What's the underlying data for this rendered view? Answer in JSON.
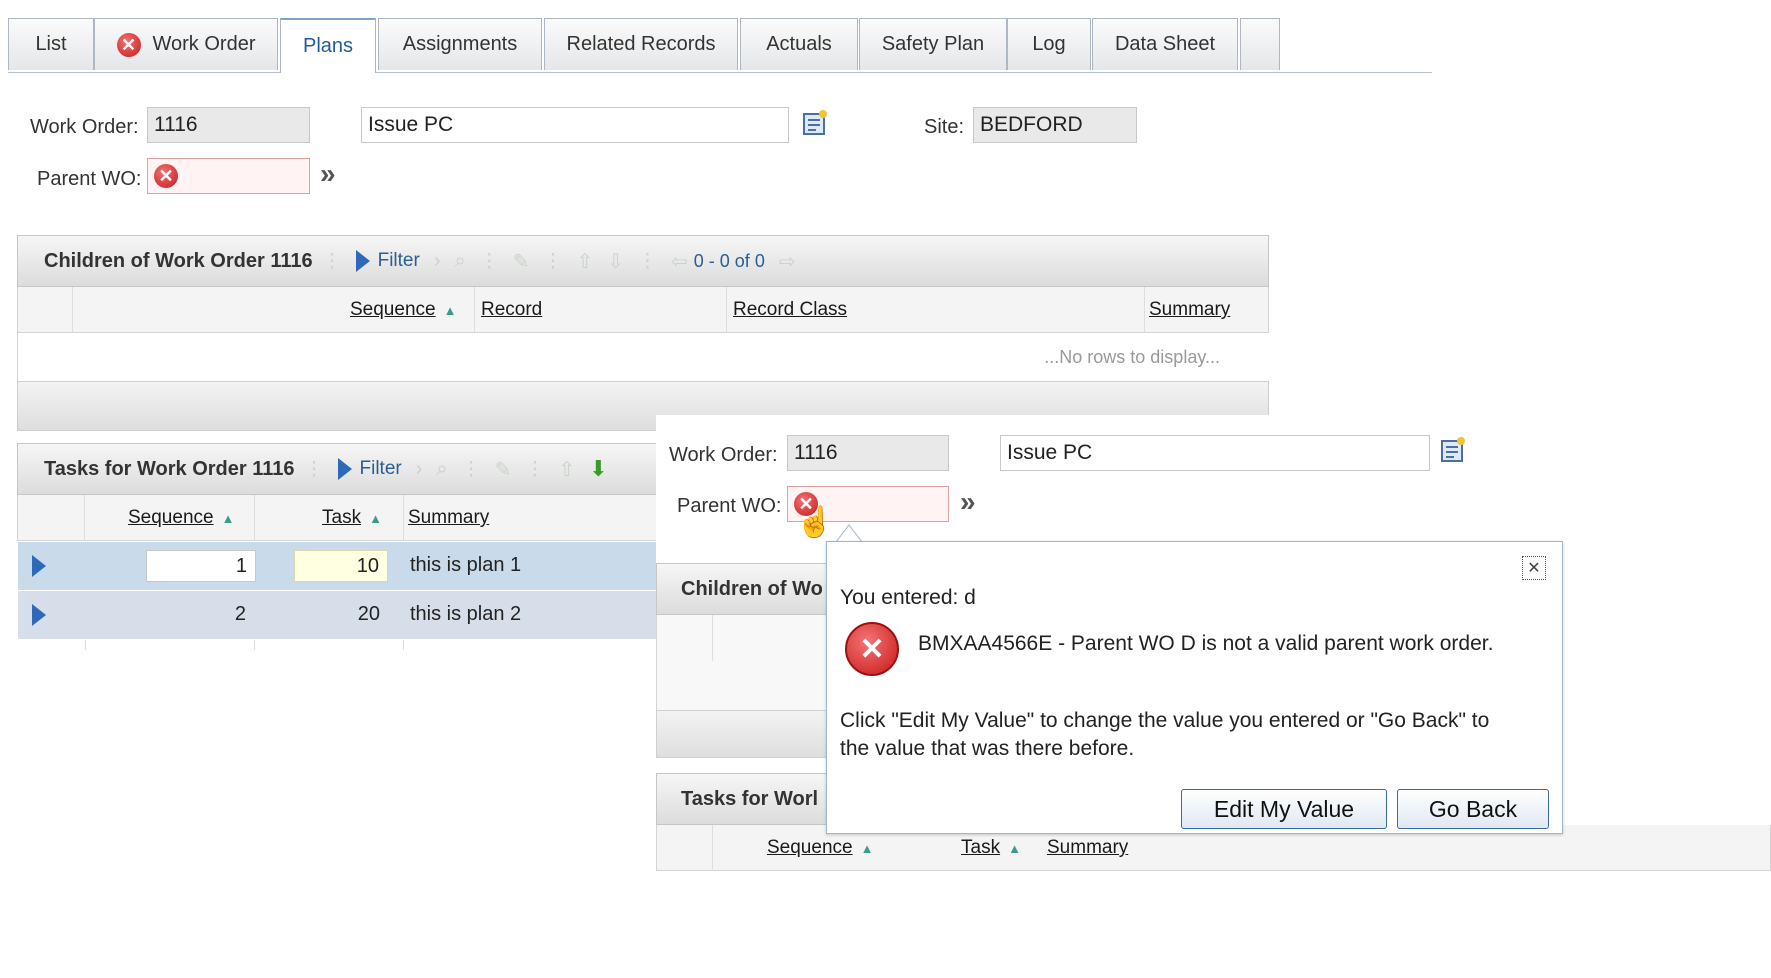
{
  "tabs": [
    {
      "label": "List"
    },
    {
      "label": "Work Order",
      "icon": "error-icon"
    },
    {
      "label": "Plans",
      "active": true
    },
    {
      "label": "Assignments"
    },
    {
      "label": "Related Records"
    },
    {
      "label": "Actuals"
    },
    {
      "label": "Safety Plan"
    },
    {
      "label": "Log"
    },
    {
      "label": "Data Sheet"
    }
  ],
  "header": {
    "work_order_label": "Work Order:",
    "work_order_value": "1116",
    "description_value": "Issue PC",
    "site_label": "Site:",
    "site_value": "BEDFORD",
    "parent_wo_label": "Parent WO:",
    "parent_wo_value": "",
    "detail_menu_symbol": "»"
  },
  "children_section": {
    "title": "Children of Work Order 1116",
    "filter_label": "Filter",
    "paging": "0 - 0 of 0",
    "columns": [
      "Sequence",
      "Record",
      "Record Class",
      "Summary"
    ],
    "empty_text": "...No rows to display..."
  },
  "tasks_section": {
    "title": "Tasks for Work Order 1116",
    "filter_label": "Filter",
    "columns": [
      "Sequence",
      "Task",
      "Summary"
    ],
    "rows": [
      {
        "sequence": "1",
        "task": "10",
        "summary": "this is plan 1"
      },
      {
        "sequence": "2",
        "task": "20",
        "summary": "this is plan 2"
      }
    ]
  },
  "popup_background": {
    "work_order_label": "Work Order:",
    "work_order_value": "1116",
    "description_value": "Issue PC",
    "parent_wo_label": "Parent WO:",
    "children_title_partial": "Children of Wo",
    "tasks_title_partial": "Tasks for Worl",
    "columns_partial": [
      "Sequence",
      "Task",
      "Summary"
    ]
  },
  "error_dialog": {
    "entered_text": "You entered: d",
    "message": "BMXAA4566E - Parent WO D is not a valid parent work order.",
    "instructions": "Click \"Edit My Value\" to change the value you entered or \"Go Back\" to the value that was there before.",
    "edit_button": "Edit My Value",
    "back_button": "Go Back"
  },
  "colors": {
    "accent": "#2e68b8",
    "error": "#d42020",
    "selected_row": "#c9daeb"
  }
}
